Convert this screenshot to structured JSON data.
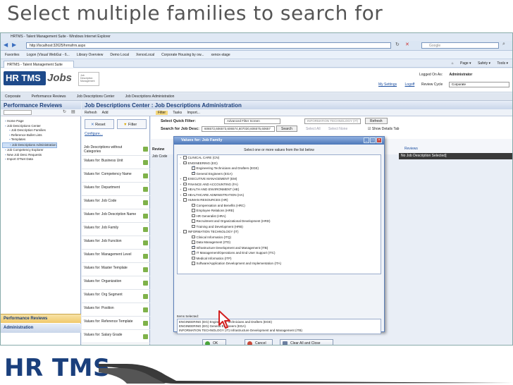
{
  "slide": {
    "title": "Select multiple families to search for"
  },
  "browser": {
    "window_title": "HRTMS - Talent Management Suite - Windows Internet Explorer",
    "address": "http://localhost:32625/hrmsfrm.aspx",
    "search_placeholder": "Google",
    "favorites": [
      "Favorites",
      "Logon (Visual WebGui - 6...",
      "Library Overview",
      "Demo Local",
      "XenoxLocal",
      "Corporate Housing by ow...",
      "xenox-stage"
    ],
    "tab_label": "HRTMS - Talent Management Suite",
    "commands": [
      "Page ▾",
      "Safety ▾",
      "Tools ▾"
    ]
  },
  "app": {
    "logo_hr": "HR TMS",
    "logo_jobs": "Jobs",
    "logo_sub": "Job Description Management",
    "logged_label": "Logged On As:",
    "logged_user": "Administrator",
    "link_settings": "My Settings",
    "link_logoff": "Logoff",
    "cycle_label": "Review Cycle",
    "cycle_value": "Corporate",
    "breadcrumbs": [
      "Corporate",
      "Performance Reviews",
      "Job Descriptions Center",
      "Job Descriptions Administration"
    ]
  },
  "left_panel": {
    "title": "Performance Reviews",
    "tree": [
      {
        "label": "Home Page",
        "indent": 0,
        "selected": false
      },
      {
        "label": "Job Descriptions Center",
        "indent": 0,
        "selected": false
      },
      {
        "label": "Job Description Families",
        "indent": 1,
        "selected": false
      },
      {
        "label": "Reference Bullet Lists",
        "indent": 1,
        "selected": false
      },
      {
        "label": "Templates",
        "indent": 1,
        "selected": false
      },
      {
        "label": "Job Descriptions Administration",
        "indent": 1,
        "selected": true
      },
      {
        "label": "Job Competency Explorer",
        "indent": 0,
        "selected": false
      },
      {
        "label": "New Job Desc Requests",
        "indent": 0,
        "selected": false
      },
      {
        "label": "Import O*Net Data",
        "indent": 0,
        "selected": false
      }
    ],
    "nav_perf": "Performance Reviews",
    "nav_admin": "Administration"
  },
  "center": {
    "title": "Job Descriptions Center : Job Descriptions Administration",
    "tools": [
      "Refresh",
      "Add",
      "Filter",
      "Tasks",
      "Import..."
    ],
    "reset_label": "Reset",
    "filter_label": "Filter",
    "configure_label": "Configure...",
    "filter_rows": [
      "Job Descriptions without Categories",
      "Values for: Business Unit",
      "Values for: Competency Name",
      "Values for: Department",
      "Values for: Job Code",
      "Values for: Job Description Name",
      "Values for: Job Family",
      "Values for: Job Function",
      "Values for: Management Level",
      "Values for: Master Template",
      "Values for: Organization",
      "Values for: Org Segment",
      "Values for: Position",
      "Values for: Reference Template",
      "Values for: Salary Grade",
      "Values for: Direct manager"
    ],
    "quick_filter_label": "Select Quick Filter:",
    "quick_filter_value": "Advanced Filter Screen",
    "quick_filter_value2": "INFORMATION TECHNOLOGY (IT)",
    "refresh_label": "Refresh",
    "search_label": "Search for Job Desc:",
    "search_value": "606572,606573,606574,607030,606575,60657",
    "search_btn": "Search",
    "select_all": "Select All",
    "select_none": "Select None",
    "show_details": "Show Details Tab",
    "reviews_label": "Review",
    "job_code_label": "Job Code",
    "no_selected": "No Job Description Selected]",
    "reviews_link": "Reviews"
  },
  "dialog": {
    "title": "Values for: Job Family",
    "instruction": "Select one or more values from the list below",
    "items": [
      {
        "label": "CLINICAL CARE (CN)",
        "level": 0,
        "checked": false,
        "toggle": "+"
      },
      {
        "label": "ENGINEERING (EG)",
        "level": 0,
        "checked": false,
        "toggle": "-"
      },
      {
        "label": "Engineering Technicians and Drafters (EGE)",
        "level": 1,
        "checked": true,
        "toggle": ""
      },
      {
        "label": "General Engineers (EGA)",
        "level": 1,
        "checked": true,
        "toggle": ""
      },
      {
        "label": "EXECUTIVE MANAGEMENT (EM)",
        "level": 0,
        "checked": false,
        "toggle": "+"
      },
      {
        "label": "FINANCE AND ACCOUNTING (FA)",
        "level": 0,
        "checked": false,
        "toggle": "+"
      },
      {
        "label": "HEALTH AND ENVIRONMENT (HE)",
        "level": 0,
        "checked": false,
        "toggle": "+"
      },
      {
        "label": "HEALTHCARE ADMINISTRATION (HA)",
        "level": 0,
        "checked": false,
        "toggle": "+"
      },
      {
        "label": "HUMAN RESOURCES (HR)",
        "level": 0,
        "checked": false,
        "toggle": "-"
      },
      {
        "label": "Compensation and Benefits (HRC)",
        "level": 1,
        "checked": false,
        "toggle": ""
      },
      {
        "label": "Employee Relations (HRE)",
        "level": 1,
        "checked": false,
        "toggle": ""
      },
      {
        "label": "HR Generalist (HRA)",
        "level": 1,
        "checked": false,
        "toggle": ""
      },
      {
        "label": "Recruitment and Organizational Development (HRD)",
        "level": 1,
        "checked": false,
        "toggle": ""
      },
      {
        "label": "Training and Development (HRB)",
        "level": 1,
        "checked": false,
        "toggle": ""
      },
      {
        "label": "INFORMATION TECHNOLOGY (IT)",
        "level": 0,
        "checked": false,
        "toggle": "-"
      },
      {
        "label": "Clinical Informatics (ITQ)",
        "level": 1,
        "checked": false,
        "toggle": ""
      },
      {
        "label": "Data Management (ITD)",
        "level": 1,
        "checked": false,
        "toggle": ""
      },
      {
        "label": "Infrastructure Development and Management (ITB)",
        "level": 1,
        "checked": true,
        "toggle": ""
      },
      {
        "label": "IT Management/Operations and End User Support (ITC)",
        "level": 1,
        "checked": true,
        "toggle": ""
      },
      {
        "label": "Medical Informatics (ITP)",
        "level": 1,
        "checked": false,
        "toggle": ""
      },
      {
        "label": "Software/Application Development and Implementation (ITA)",
        "level": 1,
        "checked": false,
        "toggle": ""
      }
    ],
    "selected_label": "Items Selected:",
    "selected_items": [
      "ENGINEERING (EG) Engineering Technicians and Drafters (EGE)",
      "ENGINEERING (EG) General Engineers (EGA)",
      "INFORMATION TECHNOLOGY (IT) Infrastructure Development and Management (ITB)"
    ],
    "ok_label": "OK",
    "cancel_label": "Cancel",
    "clear_label": "Clear All and Close"
  },
  "footer": {
    "logo": "HR TMS"
  },
  "colors": {
    "accent": "#1c3f7a",
    "brand": "#1a3f7c"
  }
}
